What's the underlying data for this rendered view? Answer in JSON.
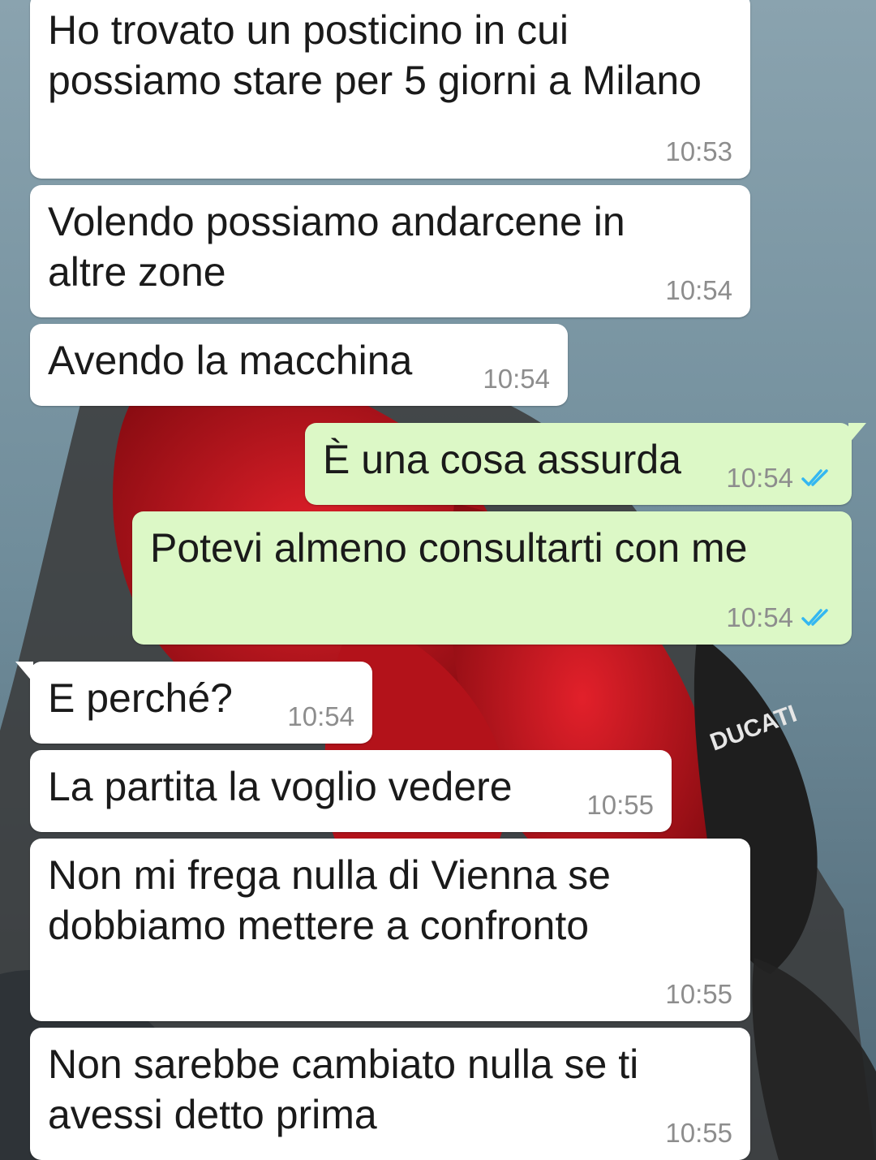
{
  "chat": {
    "messages": [
      {
        "direction": "in",
        "text": "Ho trovato un posticino in cui\npossiamo stare per 5 giorni a Milano",
        "time": "10:53"
      },
      {
        "direction": "in",
        "text": "Volendo possiamo andarcene in\naltre zone",
        "time": "10:54"
      },
      {
        "direction": "in",
        "text": "Avendo la macchina",
        "time": "10:54"
      },
      {
        "direction": "out",
        "text": "È una cosa assurda",
        "time": "10:54",
        "status": "read"
      },
      {
        "direction": "out",
        "text": "Potevi almeno consultarti con me",
        "time": "10:54",
        "status": "read"
      },
      {
        "direction": "in",
        "text": "E perché?",
        "time": "10:54"
      },
      {
        "direction": "in",
        "text": "La partita la voglio vedere",
        "time": "10:55"
      },
      {
        "direction": "in",
        "text": "Non mi frega nulla di Vienna se\ndobbiamo mettere a confronto",
        "time": "10:55"
      },
      {
        "direction": "in",
        "text": "Non sarebbe cambiato nulla se ti\navessi detto prima",
        "time": "10:55"
      }
    ]
  },
  "wallpaper": {
    "logo_text": "DUCATI"
  },
  "colors": {
    "incoming_bubble": "#ffffff",
    "outgoing_bubble": "#dcf8c6",
    "timestamp": "#8d8d8d",
    "read_tick": "#34b7f1",
    "text": "#1a1a1a"
  },
  "icons": {
    "read_receipt": "double-check-icon"
  }
}
